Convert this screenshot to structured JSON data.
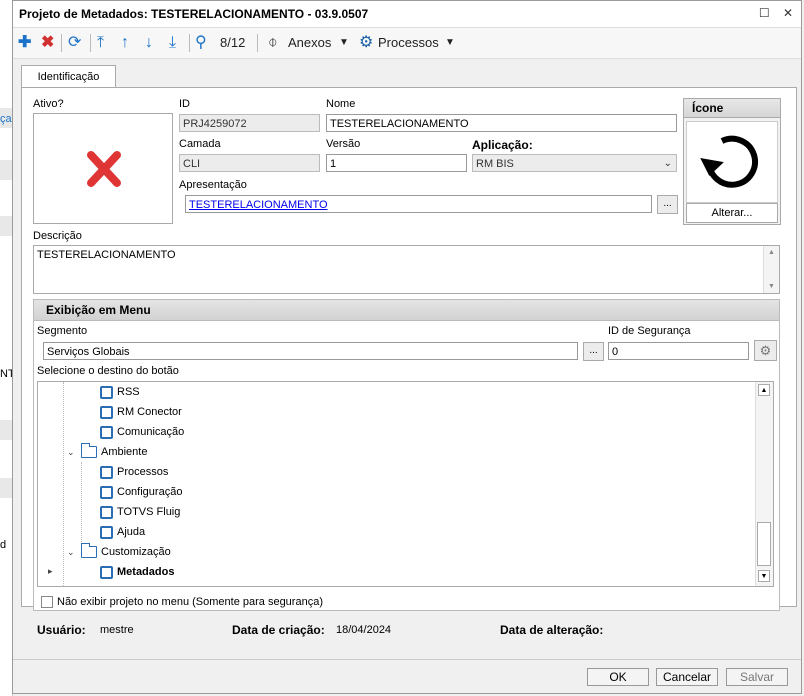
{
  "window": {
    "title": "Projeto de Metadados: TESTERELACIONAMENTO - 03.9.0507"
  },
  "toolbar": {
    "position": "8/12",
    "anexos_label": "Anexos",
    "processos_label": "Processos"
  },
  "tabs": [
    {
      "label": "Identificação"
    }
  ],
  "form": {
    "ativo_label": "Ativo?",
    "id_label": "ID",
    "id_value": "PRJ4259072",
    "nome_label": "Nome",
    "nome_value": "TESTERELACIONAMENTO",
    "camada_label": "Camada",
    "camada_value": "CLI",
    "versao_label": "Versão",
    "versao_value": "1",
    "aplicacao_label": "Aplicação:",
    "aplicacao_value": "RM BIS",
    "apresentacao_label": "Apresentação",
    "apresentacao_value": "TESTERELACIONAMENTO",
    "icone_label": "Ícone",
    "alterar_label": "Alterar...",
    "descricao_label": "Descrição",
    "descricao_value": "TESTERELACIONAMENTO"
  },
  "menu": {
    "header": "Exibição em Menu",
    "segmento_label": "Segmento",
    "segmento_value": "Serviços Globais",
    "id_seguranca_label": "ID de Segurança",
    "id_seguranca_value": "0",
    "destino_label": "Selecione o destino do botão",
    "tree": [
      {
        "label": "RSS",
        "type": "doc"
      },
      {
        "label": "RM Conector",
        "type": "doc"
      },
      {
        "label": "Comunicação",
        "type": "doc"
      },
      {
        "label": "Ambiente",
        "type": "folder"
      },
      {
        "label": "Processos",
        "type": "doc"
      },
      {
        "label": "Configuração",
        "type": "doc"
      },
      {
        "label": "TOTVS Fluig",
        "type": "doc"
      },
      {
        "label": "Ajuda",
        "type": "doc"
      },
      {
        "label": "Customização",
        "type": "folder"
      },
      {
        "label": "Metadados",
        "type": "doc"
      }
    ],
    "nao_exibir_label": "Não exibir projeto no menu (Somente para segurança)"
  },
  "footer": {
    "usuario_label": "Usuário:",
    "usuario_value": "mestre",
    "criacao_label": "Data de criação:",
    "criacao_value": "18/04/2024",
    "alteracao_label": "Data de alteração:",
    "alteracao_value": ""
  },
  "buttons": {
    "ok": "OK",
    "cancelar": "Cancelar",
    "salvar": "Salvar"
  },
  "background": {
    "frag1": "ça",
    "frag2": "NT",
    "frag3": "d"
  },
  "colors": {
    "accent": "#1a73c8",
    "delete": "#d03030",
    "link": "#0000ee"
  }
}
